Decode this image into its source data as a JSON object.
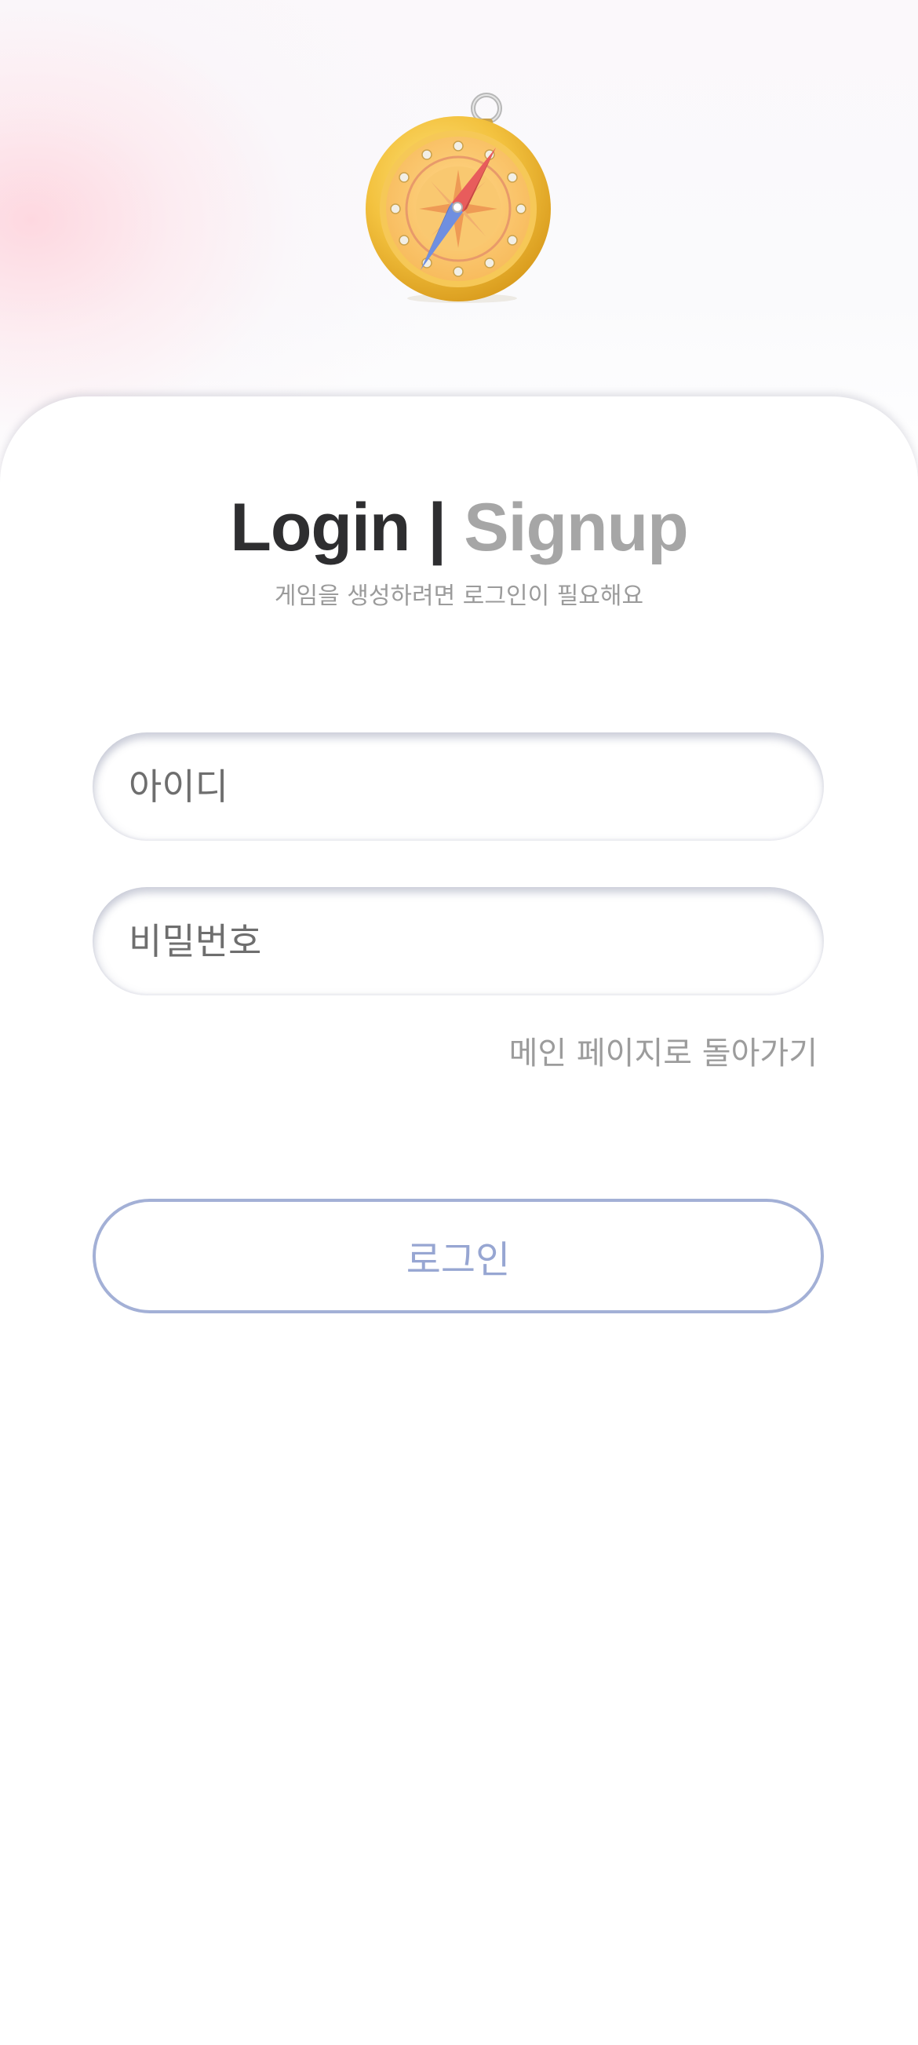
{
  "header": {
    "logo_icon": "compass-icon"
  },
  "auth": {
    "title_login": "Login",
    "title_separator": "|",
    "title_signup": "Signup",
    "subtitle": "게임을 생성하려면 로그인이 필요해요"
  },
  "form": {
    "id_placeholder": "아이디",
    "password_placeholder": "비밀번호",
    "back_link": "메인 페이지로 돌아가기",
    "login_button": "로그인"
  },
  "colors": {
    "title_active": "#2e2e30",
    "title_inactive": "#a6a6a6",
    "button_accent": "#a3b0d6",
    "background_blush": "#ffd3dc"
  }
}
